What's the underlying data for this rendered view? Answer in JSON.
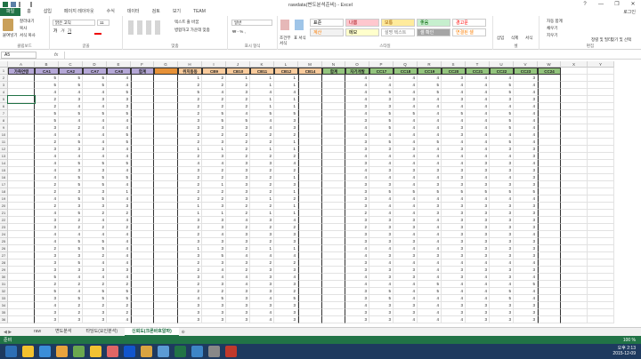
{
  "window": {
    "title": "rawdata(변도분석준비) - Excel",
    "minimize": "—",
    "restore": "❐",
    "close": "✕"
  },
  "tabs": [
    "파일",
    "홈",
    "삽입",
    "페이지 레이아웃",
    "수식",
    "데이터",
    "검토",
    "보기",
    "TEAM"
  ],
  "user": "로그인",
  "ribbon": {
    "clipboard": {
      "label": "클립보드",
      "paste": "붙여넣기",
      "cut": "잘라내기",
      "copy": "복사",
      "format_painter": "서식 복사"
    },
    "font": {
      "label": "글꼴",
      "name": "맑은 고딕",
      "size": "11"
    },
    "alignment": {
      "label": "맞춤",
      "wrap": "텍스트 줄 바꿈",
      "merge": "병합하고 가운데 맞춤"
    },
    "number": {
      "label": "표시 형식",
      "format": "일반"
    },
    "styles": {
      "label": "스타일",
      "conditional": "조건부 서식",
      "table": "표 서식",
      "items": [
        {
          "label": "표준",
          "bg": "#ffffff",
          "fg": "#000000"
        },
        {
          "label": "나쁨",
          "bg": "#ffc7ce",
          "fg": "#9c0006"
        },
        {
          "label": "보통",
          "bg": "#ffeb9c",
          "fg": "#9c5700"
        },
        {
          "label": "좋음",
          "bg": "#c6efce",
          "fg": "#006100"
        },
        {
          "label": "경고문",
          "bg": "#ffffff",
          "fg": "#ff0000"
        },
        {
          "label": "계산",
          "bg": "#f2f2f2",
          "fg": "#fa7d00"
        },
        {
          "label": "메모",
          "bg": "#ffffcc",
          "fg": "#000000"
        },
        {
          "label": "설명 텍스트",
          "bg": "#ffffff",
          "fg": "#7f7f7f"
        },
        {
          "label": "셀 확인",
          "bg": "#a5a5a5",
          "fg": "#ffffff"
        },
        {
          "label": "연결된 셀",
          "bg": "#ffffff",
          "fg": "#fa7d00"
        }
      ]
    },
    "cells": {
      "label": "셀",
      "insert": "삽입",
      "delete": "삭제",
      "format": "서식"
    },
    "editing": {
      "label": "편집",
      "autosum": "자동 합계",
      "fill": "채우기",
      "clear": "지우기",
      "sort": "정렬 및 필터",
      "find": "찾기 및 선택"
    }
  },
  "formula_bar": {
    "name_box": "A5",
    "fx": "fx",
    "value": ""
  },
  "columns": [
    "A",
    "B",
    "C",
    "D",
    "E",
    "F",
    "G",
    "H",
    "I",
    "J",
    "K",
    "L",
    "M",
    "N",
    "O",
    "P",
    "Q",
    "R",
    "S",
    "T",
    "U",
    "V",
    "W",
    "X",
    "Y"
  ],
  "header_row": [
    "가족연령",
    "CA1",
    "CA2",
    "CA7",
    "CA8",
    "합계",
    "",
    "위치동동",
    "CB9",
    "CB10",
    "CB11",
    "CB12",
    "CB14",
    "합계",
    "자기개발",
    "CC17",
    "CC18",
    "CC19",
    "CC20",
    "CC21",
    "CC22",
    "CC23",
    "CC24",
    "합계",
    "",
    ""
  ],
  "header_colors": {
    "A": "#b4a7d6",
    "B_E": "#b4a7d6",
    "F": "#b4a7d6",
    "G": "#e69138",
    "H_M": "#f9cb9c",
    "N": "#93c47d",
    "O_W": "#93c47d"
  },
  "rows": [
    [
      5,
      5,
      5,
      4,
      5
    ],
    [
      5,
      5,
      5,
      4
    ],
    [
      4,
      4,
      4,
      5
    ],
    [
      2,
      3,
      3,
      3
    ],
    [
      2,
      4,
      4,
      3
    ],
    [
      5,
      5,
      5,
      5
    ],
    [
      5,
      4,
      4,
      4
    ],
    [
      3,
      2,
      4,
      4
    ],
    [
      4,
      4,
      4,
      5
    ],
    [
      2,
      5,
      4,
      5
    ],
    [
      3,
      3,
      3,
      4
    ],
    [
      4,
      4,
      4,
      4
    ],
    [
      4,
      5,
      5,
      5
    ],
    [
      4,
      3,
      3,
      4
    ],
    [
      4,
      5,
      5,
      5
    ],
    [
      2,
      5,
      5,
      4
    ],
    [
      2,
      3,
      3,
      1
    ],
    [
      4,
      5,
      5,
      4
    ],
    [
      2,
      3,
      3,
      3
    ],
    [
      4,
      5,
      2,
      2
    ],
    [
      3,
      2,
      4,
      4
    ],
    [
      3,
      2,
      2,
      2
    ],
    [
      4,
      4,
      4,
      4
    ],
    [
      4,
      5,
      5,
      4
    ],
    [
      2,
      5,
      5,
      4
    ],
    [
      3,
      3,
      2,
      4
    ],
    [
      3,
      5,
      4,
      4
    ],
    [
      3,
      3,
      3,
      3
    ],
    [
      5,
      4,
      4,
      4
    ],
    [
      2,
      2,
      2,
      2
    ],
    [
      5,
      4,
      5,
      5
    ],
    [
      3,
      5,
      5,
      5
    ],
    [
      4,
      2,
      2,
      2
    ],
    [
      3,
      2,
      3,
      2
    ],
    [
      3,
      3,
      3,
      4
    ]
  ],
  "rows_mid": [
    [
      1,
      2,
      1,
      1,
      1
    ],
    [
      2,
      2,
      2,
      1,
      1
    ],
    [
      5,
      4,
      3,
      4,
      4
    ],
    [
      2,
      2,
      2,
      1,
      1
    ],
    [
      2,
      2,
      2,
      1,
      1
    ],
    [
      2,
      5,
      4,
      5,
      5
    ],
    [
      3,
      5,
      5,
      4,
      3
    ],
    [
      3,
      3,
      3,
      4,
      3
    ],
    [
      2,
      2,
      2,
      2,
      2
    ],
    [
      2,
      3,
      2,
      2,
      1
    ],
    [
      1,
      1,
      2,
      1,
      1
    ],
    [
      2,
      3,
      2,
      2,
      2
    ],
    [
      4,
      4,
      3,
      3,
      4
    ],
    [
      3,
      2,
      3,
      2,
      2
    ],
    [
      2,
      2,
      3,
      2,
      1
    ],
    [
      2,
      1,
      3,
      2,
      3
    ],
    [
      2,
      2,
      3,
      2,
      1
    ],
    [
      2,
      2,
      3,
      1,
      2
    ],
    [
      1,
      3,
      2,
      2,
      1
    ],
    [
      1,
      1,
      2,
      1,
      1
    ],
    [
      3,
      3,
      4,
      3,
      4
    ],
    [
      2,
      3,
      2,
      2,
      2
    ],
    [
      2,
      4,
      3,
      3,
      3
    ],
    [
      3,
      3,
      3,
      2,
      3
    ],
    [
      1,
      3,
      2,
      1,
      1
    ],
    [
      3,
      5,
      4,
      4,
      4
    ],
    [
      2,
      3,
      3,
      2,
      2
    ],
    [
      2,
      4,
      2,
      3,
      3
    ],
    [
      3,
      4,
      4,
      3,
      4
    ],
    [
      2,
      3,
      4,
      3,
      3
    ],
    [
      2,
      2,
      3,
      3,
      2
    ],
    [
      4,
      5,
      3,
      4,
      5
    ],
    [
      3,
      3,
      3,
      3,
      3
    ],
    [
      3,
      3,
      3,
      4,
      3
    ],
    [
      3,
      3,
      3,
      4,
      3
    ]
  ],
  "rows_right": [
    [
      4,
      4,
      4,
      4,
      3,
      4,
      4,
      3
    ],
    [
      4,
      4,
      4,
      5,
      4,
      4,
      5,
      4
    ],
    [
      4,
      5,
      4,
      5,
      4,
      4,
      5,
      4
    ],
    [
      4,
      3,
      3,
      4,
      3,
      4,
      3,
      3
    ],
    [
      3,
      3,
      4,
      4,
      4,
      4,
      4,
      4
    ],
    [
      4,
      5,
      5,
      4,
      5,
      4,
      5,
      4
    ],
    [
      3,
      5,
      4,
      4,
      4,
      4,
      5,
      4
    ],
    [
      4,
      5,
      4,
      4,
      3,
      4,
      5,
      4
    ],
    [
      4,
      4,
      4,
      4,
      3,
      4,
      4,
      4
    ],
    [
      3,
      5,
      4,
      5,
      4,
      4,
      5,
      4
    ],
    [
      3,
      3,
      3,
      4,
      3,
      4,
      3,
      3
    ],
    [
      4,
      4,
      4,
      4,
      4,
      4,
      4,
      3
    ],
    [
      3,
      4,
      4,
      4,
      4,
      3,
      3,
      4
    ],
    [
      4,
      3,
      3,
      3,
      3,
      3,
      3,
      3
    ],
    [
      4,
      4,
      4,
      4,
      3,
      4,
      4,
      3
    ],
    [
      3,
      3,
      4,
      3,
      3,
      3,
      3,
      3
    ],
    [
      3,
      5,
      5,
      5,
      5,
      5,
      5,
      5
    ],
    [
      3,
      4,
      4,
      4,
      4,
      4,
      4,
      4
    ],
    [
      3,
      4,
      4,
      3,
      3,
      3,
      3,
      3
    ],
    [
      2,
      4,
      4,
      3,
      3,
      3,
      3,
      3
    ],
    [
      3,
      3,
      3,
      4,
      3,
      3,
      3,
      3
    ],
    [
      2,
      3,
      3,
      4,
      3,
      3,
      3,
      3
    ],
    [
      3,
      3,
      4,
      4,
      3,
      3,
      3,
      4
    ],
    [
      3,
      3,
      3,
      4,
      3,
      3,
      3,
      3
    ],
    [
      4,
      4,
      4,
      4,
      3,
      3,
      3,
      3
    ],
    [
      4,
      3,
      3,
      3,
      3,
      3,
      3,
      3
    ],
    [
      3,
      4,
      4,
      4,
      4,
      4,
      4,
      4
    ],
    [
      3,
      3,
      3,
      4,
      3,
      3,
      3,
      3
    ],
    [
      4,
      3,
      3,
      4,
      3,
      4,
      3,
      4
    ],
    [
      4,
      4,
      4,
      5,
      4,
      4,
      4,
      5
    ],
    [
      3,
      5,
      4,
      5,
      4,
      4,
      5,
      4
    ],
    [
      3,
      5,
      4,
      4,
      4,
      4,
      5,
      4
    ],
    [
      4,
      3,
      3,
      4,
      3,
      3,
      3,
      3
    ],
    [
      3,
      3,
      3,
      4,
      3,
      3,
      3,
      3
    ],
    [
      3,
      3,
      4,
      4,
      4,
      3,
      3,
      3
    ]
  ],
  "sheet_tabs": [
    "raw",
    "변도분석",
    "타당도(요인분석)",
    "신뢰도(크론바흐알파)"
  ],
  "active_sheet": "신뢰도(크론바흐알파)",
  "status": {
    "ready": "준비",
    "zoom": "100 %"
  },
  "clock": {
    "time": "오후 2:13",
    "date": "2015-12-09"
  }
}
